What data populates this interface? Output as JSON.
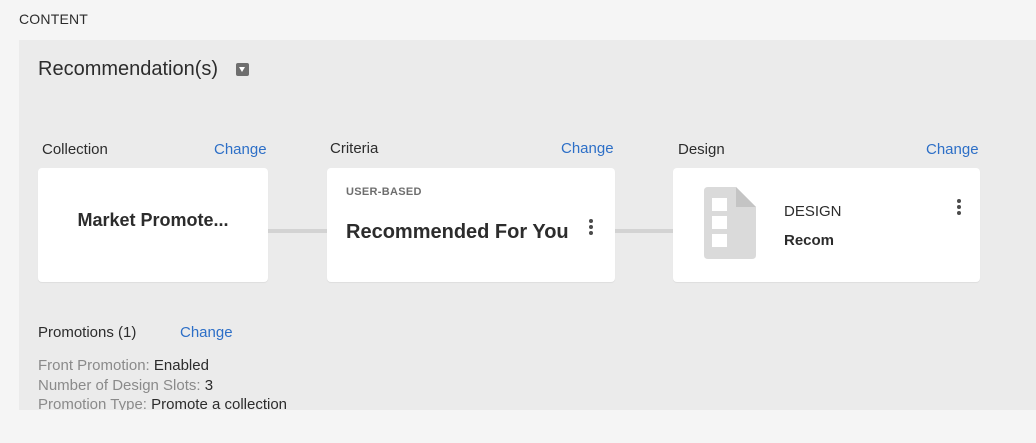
{
  "section_label": "CONTENT",
  "panel": {
    "title": "Recommendation(s)"
  },
  "collection": {
    "label": "Collection",
    "change_label": "Change",
    "name": "Market Promote..."
  },
  "criteria": {
    "label": "Criteria",
    "change_label": "Change",
    "type": "USER-BASED",
    "name": "Recommended For You"
  },
  "design": {
    "label": "Design",
    "change_label": "Change",
    "type": "DESIGN",
    "name": "Recom"
  },
  "promotions": {
    "label": "Promotions (1)",
    "change_label": "Change",
    "details": [
      {
        "key": "Front Promotion:",
        "value": "Enabled"
      },
      {
        "key": "Number of Design Slots:",
        "value": "3"
      },
      {
        "key": "Promotion Type:",
        "value": "Promote a collection"
      }
    ]
  },
  "colors": {
    "link": "#2d6fc7",
    "panel_bg": "#ebebeb",
    "card_bg": "#ffffff",
    "connector": "#d3d3d3"
  },
  "icons": {
    "collapse": "chevron-down-icon",
    "more": "more-vertical-icon",
    "design": "document-layout-icon"
  }
}
